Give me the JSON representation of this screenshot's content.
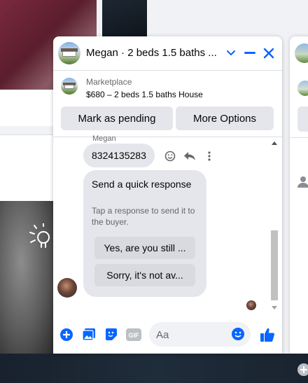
{
  "colors": {
    "accent": "#0866ff",
    "button_bg": "#e4e6eb",
    "bubble_bg": "#e4e6eb",
    "secondary_text": "#65676b"
  },
  "chat": {
    "title": "Megan · 2 beds 1.5 baths ...",
    "header_icons": [
      "chevron-down-icon",
      "minimize-icon",
      "close-icon"
    ],
    "marketplace": {
      "label": "Marketplace",
      "listing": "$680 – 2 beds 1.5 baths House"
    },
    "actions": {
      "pending": "Mark as pending",
      "more": "More Options"
    },
    "conversation": {
      "sender_name": "Megan",
      "phone_message": "8324135283",
      "message_tools": [
        "react-icon",
        "reply-icon",
        "more-icon"
      ],
      "quick_response": {
        "title": "Send a quick response",
        "subtitle": "Tap a response to send it to the buyer.",
        "options": [
          "Yes, are you still ...",
          "Sorry, it's not av..."
        ]
      }
    },
    "composer": {
      "placeholder": "Aa",
      "icons": [
        "plus-icon",
        "photo-icon",
        "sticker-icon",
        "gif-icon",
        "emoji-icon",
        "like-icon"
      ]
    }
  }
}
